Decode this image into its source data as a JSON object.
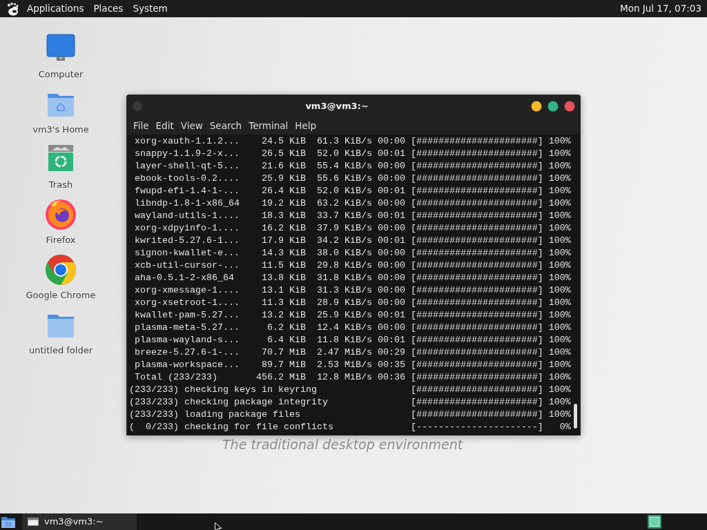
{
  "top_panel": {
    "menus": [
      "Applications",
      "Places",
      "System"
    ],
    "clock": "Mon Jul 17, 07:03"
  },
  "desktop_icons": [
    {
      "kind": "computer",
      "label": "Computer"
    },
    {
      "kind": "home",
      "label": "vm3's Home"
    },
    {
      "kind": "trash",
      "label": "Trash"
    },
    {
      "kind": "firefox",
      "label": "Firefox"
    },
    {
      "kind": "chrome",
      "label": "Google Chrome"
    },
    {
      "kind": "folder",
      "label": "untitled folder"
    }
  ],
  "wallpaper": {
    "tagline": "The traditional desktop environment"
  },
  "terminal": {
    "title": "vm3@vm3:~",
    "menu": [
      "File",
      "Edit",
      "View",
      "Search",
      "Terminal",
      "Help"
    ],
    "downloads": [
      {
        "name": "xorg-xauth-1.1.2...",
        "size": "24.5 KiB",
        "rate": "61.3 KiB/s",
        "eta": "00:00",
        "bar": "[######################]",
        "percent": "100%"
      },
      {
        "name": "snappy-1.1.9-2-x...",
        "size": "26.5 KiB",
        "rate": "52.0 KiB/s",
        "eta": "00:01",
        "bar": "[######################]",
        "percent": "100%"
      },
      {
        "name": "layer-shell-qt-5...",
        "size": "21.6 KiB",
        "rate": "55.4 KiB/s",
        "eta": "00:00",
        "bar": "[######################]",
        "percent": "100%"
      },
      {
        "name": "ebook-tools-0.2....",
        "size": "25.9 KiB",
        "rate": "55.6 KiB/s",
        "eta": "00:00",
        "bar": "[######################]",
        "percent": "100%"
      },
      {
        "name": "fwupd-efi-1.4-1-...",
        "size": "26.4 KiB",
        "rate": "52.0 KiB/s",
        "eta": "00:01",
        "bar": "[######################]",
        "percent": "100%"
      },
      {
        "name": "libndp-1.8-1-x86_64",
        "size": "19.2 KiB",
        "rate": "63.2 KiB/s",
        "eta": "00:00",
        "bar": "[######################]",
        "percent": "100%"
      },
      {
        "name": "wayland-utils-1....",
        "size": "18.3 KiB",
        "rate": "33.7 KiB/s",
        "eta": "00:01",
        "bar": "[######################]",
        "percent": "100%"
      },
      {
        "name": "xorg-xdpyinfo-1....",
        "size": "16.2 KiB",
        "rate": "37.9 KiB/s",
        "eta": "00:00",
        "bar": "[######################]",
        "percent": "100%"
      },
      {
        "name": "kwrited-5.27.6-1...",
        "size": "17.9 KiB",
        "rate": "34.2 KiB/s",
        "eta": "00:01",
        "bar": "[######################]",
        "percent": "100%"
      },
      {
        "name": "signon-kwallet-e...",
        "size": "14.3 KiB",
        "rate": "38.0 KiB/s",
        "eta": "00:00",
        "bar": "[######################]",
        "percent": "100%"
      },
      {
        "name": "xcb-util-cursor-...",
        "size": "11.5 KiB",
        "rate": "29.8 KiB/s",
        "eta": "00:00",
        "bar": "[######################]",
        "percent": "100%"
      },
      {
        "name": "aha-0.5.1-2-x86_64",
        "size": "13.8 KiB",
        "rate": "31.8 KiB/s",
        "eta": "00:00",
        "bar": "[######################]",
        "percent": "100%"
      },
      {
        "name": "xorg-xmessage-1....",
        "size": "13.1 KiB",
        "rate": "31.3 KiB/s",
        "eta": "00:00",
        "bar": "[######################]",
        "percent": "100%"
      },
      {
        "name": "xorg-xsetroot-1....",
        "size": "11.3 KiB",
        "rate": "28.9 KiB/s",
        "eta": "00:00",
        "bar": "[######################]",
        "percent": "100%"
      },
      {
        "name": "kwallet-pam-5.27...",
        "size": "13.2 KiB",
        "rate": "25.9 KiB/s",
        "eta": "00:01",
        "bar": "[######################]",
        "percent": "100%"
      },
      {
        "name": "plasma-meta-5.27...",
        "size": "6.2 KiB",
        "rate": "12.4 KiB/s",
        "eta": "00:00",
        "bar": "[######################]",
        "percent": "100%"
      },
      {
        "name": "plasma-wayland-s...",
        "size": "6.4 KiB",
        "rate": "11.8 KiB/s",
        "eta": "00:01",
        "bar": "[######################]",
        "percent": "100%"
      },
      {
        "name": "breeze-5.27.6-1-...",
        "size": "70.7 MiB",
        "rate": "2.47 MiB/s",
        "eta": "00:29",
        "bar": "[######################]",
        "percent": "100%"
      },
      {
        "name": "plasma-workspace...",
        "size": "89.7 MiB",
        "rate": "2.53 MiB/s",
        "eta": "00:35",
        "bar": "[######################]",
        "percent": "100%"
      },
      {
        "name": "Total (233/233)",
        "size": "456.2 MiB",
        "rate": "12.8 MiB/s",
        "eta": "00:36",
        "bar": "[######################]",
        "percent": "100%"
      }
    ],
    "steps": [
      {
        "text": "(233/233) checking keys in keyring",
        "bar": "[######################]",
        "percent": "100%"
      },
      {
        "text": "(233/233) checking package integrity",
        "bar": "[######################]",
        "percent": "100%"
      },
      {
        "text": "(233/233) loading package files",
        "bar": "[######################]",
        "percent": "100%"
      },
      {
        "text": "(  0/233) checking for file conflicts",
        "bar": "[----------------------]",
        "percent": "0%"
      }
    ]
  },
  "taskbar": {
    "windows": [
      {
        "title": "vm3@vm3:~"
      }
    ]
  }
}
